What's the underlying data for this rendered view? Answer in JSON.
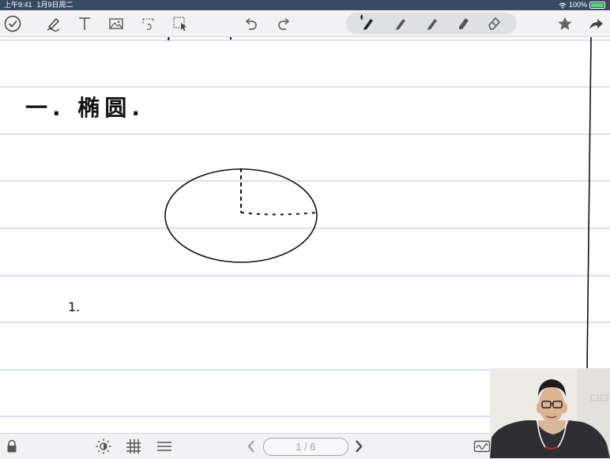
{
  "status_bar": {
    "time": "上午9:41",
    "date": "1月9日周二",
    "battery": "100%"
  },
  "toolbar": {
    "left_tools": [
      "check-circle-icon",
      "pen-icon",
      "text-icon",
      "image-icon",
      "lasso-icon",
      "selection-icon"
    ],
    "history": [
      "undo-icon",
      "redo-icon"
    ],
    "pens": [
      "bluetooth-pen-icon",
      "pen-icon",
      "pen-icon",
      "highlighter-icon",
      "eraser-icon"
    ],
    "right_tools": [
      "star-icon",
      "share-icon"
    ]
  },
  "note": {
    "heading": "一. 椭圆.",
    "list_marker": "1."
  },
  "bottom_bar": {
    "page_indicator": "1 / 6",
    "icons": [
      "lock-icon",
      "brightness-icon",
      "grid-icon",
      "lines-icon",
      "prev-page-icon",
      "next-page-icon",
      "signature-icon"
    ]
  },
  "colors": {
    "status_bar": "#3a4a63",
    "toolbar_bg": "#f2f2f4",
    "ruled_line": "#cfd9ea",
    "ink": "#111111",
    "icon": "#555555",
    "page_indicator": "#9aa3b8"
  }
}
